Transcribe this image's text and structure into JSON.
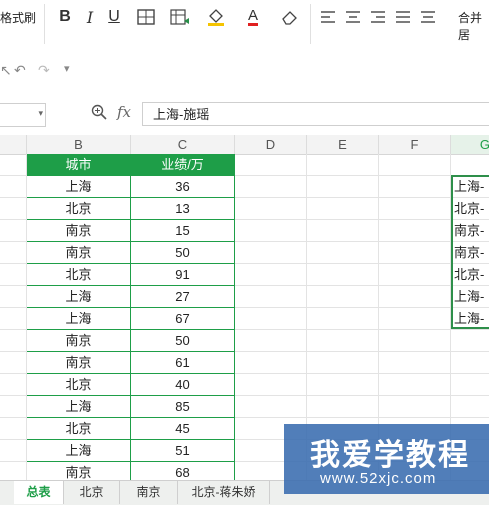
{
  "ribbon": {
    "format_painter": "格式刷",
    "bold": "B",
    "italic": "I",
    "underline": "U",
    "border_icon": "border-icon",
    "fill_icon": "fill-color-icon",
    "font_color_label": "A",
    "eraser_icon": "eraser-icon",
    "merge_label": "合并居"
  },
  "formula_bar": {
    "fx": "fx",
    "value": "上海-施瑶"
  },
  "columns": [
    "B",
    "C",
    "D",
    "E",
    "F",
    "G"
  ],
  "table": {
    "headers": [
      "城市",
      "业绩/万"
    ],
    "rows": [
      [
        "上海",
        "36"
      ],
      [
        "北京",
        "13"
      ],
      [
        "南京",
        "15"
      ],
      [
        "南京",
        "50"
      ],
      [
        "北京",
        "91"
      ],
      [
        "上海",
        "27"
      ],
      [
        "上海",
        "67"
      ],
      [
        "南京",
        "50"
      ],
      [
        "南京",
        "61"
      ],
      [
        "北京",
        "40"
      ],
      [
        "上海",
        "85"
      ],
      [
        "北京",
        "45"
      ],
      [
        "上海",
        "51"
      ],
      [
        "南京",
        "68"
      ]
    ]
  },
  "g_column": [
    "上海-",
    "北京-",
    "南京-",
    "南京-",
    "北京-",
    "上海-",
    "上海-"
  ],
  "sheet_tabs": [
    "总表",
    "北京",
    "南京",
    "北京-蒋朱娇"
  ],
  "watermark": {
    "title": "我爱学教程",
    "url": "www.52xjc.com"
  },
  "colors": {
    "accent": "#1e9e48",
    "watermark": "#3a6db0"
  }
}
